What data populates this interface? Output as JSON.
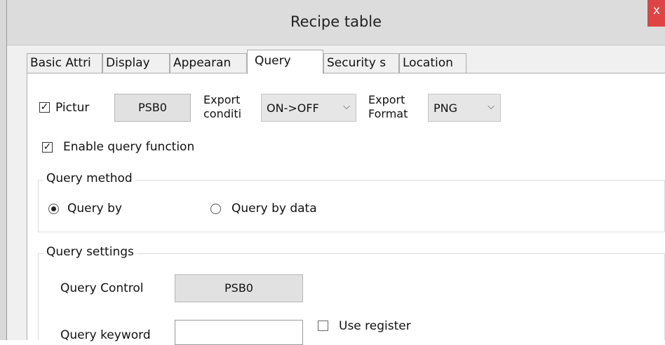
{
  "window": {
    "title": "Recipe table",
    "close_glyph": "x"
  },
  "tabs": [
    {
      "label": "Basic Attri"
    },
    {
      "label": "Display"
    },
    {
      "label": "Appearan"
    },
    {
      "label": "Query"
    },
    {
      "label": "Security s"
    },
    {
      "label": "Location"
    }
  ],
  "active_tab": "Query",
  "picture": {
    "checkbox_label": "Pictur",
    "checked": true,
    "address_button": "PSB0",
    "export_condition_label_1": "Export",
    "export_condition_label_2": "conditi",
    "export_condition_value": "ON->OFF",
    "export_format_label_1": "Export",
    "export_format_label_2": "Format",
    "export_format_value": "PNG"
  },
  "enable_query": {
    "label": "Enable query function",
    "checked": true
  },
  "query_method": {
    "title": "Query method",
    "options": [
      {
        "label": "Query by",
        "selected": true
      },
      {
        "label": "Query by data",
        "selected": false
      }
    ]
  },
  "query_settings": {
    "title": "Query settings",
    "control_label": "Query Control",
    "control_button": "PSB0",
    "keyword_label": "Query keyword",
    "keyword_value": "",
    "use_register_label": "Use register",
    "use_register_checked": false
  },
  "icons": {
    "check": "checkmark-icon",
    "dropdown": "chevron-down-icon",
    "close": "close-icon"
  }
}
